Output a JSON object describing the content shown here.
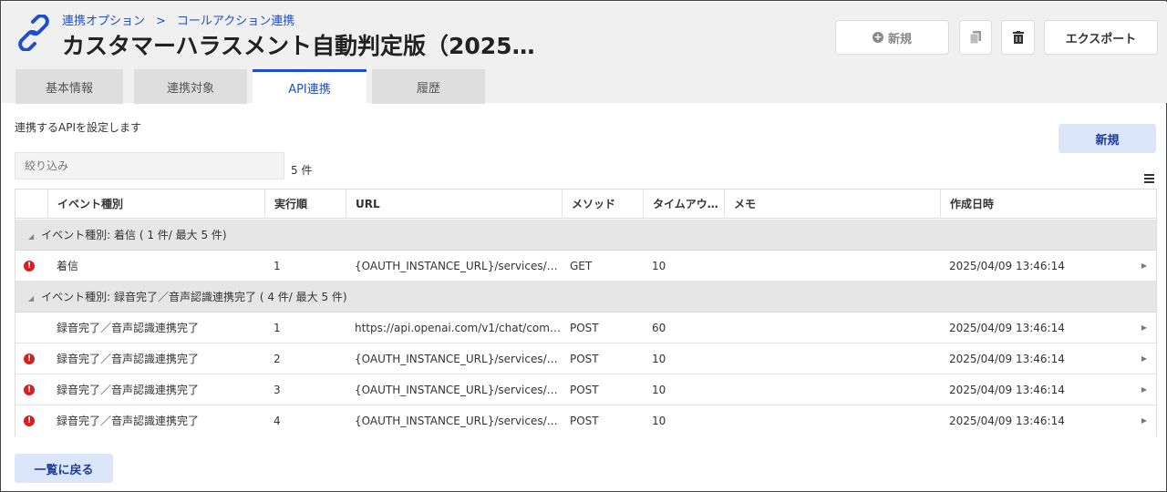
{
  "breadcrumb": [
    "連携オプション",
    ">",
    "コールアクション連携"
  ],
  "title": "カスタマーハラスメント自動判定版（2025…",
  "toolbar": {
    "new_label": "新規",
    "export_label": "エクスポート"
  },
  "tabs": [
    {
      "label": "基本情報",
      "active": false
    },
    {
      "label": "連携対象",
      "active": false
    },
    {
      "label": "API連携",
      "active": true
    },
    {
      "label": "履歴",
      "active": false
    }
  ],
  "description": "連携するAPIを設定します",
  "new_button_label": "新規",
  "filter": {
    "placeholder": "絞り込み"
  },
  "count_label": "5 件",
  "columns": [
    "イベント種別",
    "実行順",
    "URL",
    "メソッド",
    "タイムアウ…",
    "メモ",
    "作成日時"
  ],
  "groups": [
    {
      "label": "イベント種別: 着信 ( 1 件/ 最大 5 件)",
      "rows": [
        {
          "error": true,
          "event": "着信",
          "order": "1",
          "url": "{OAUTH_INSTANCE_URL}/services/…",
          "method": "GET",
          "timeout": "10",
          "memo": "",
          "created": "2025/04/09 13:46:14"
        }
      ]
    },
    {
      "label": "イベント種別: 録音完了／音声認識連携完了 ( 4 件/ 最大 5 件)",
      "rows": [
        {
          "error": false,
          "event": "録音完了／音声認識連携完了",
          "order": "1",
          "url": "https://api.openai.com/v1/chat/com…",
          "method": "POST",
          "timeout": "60",
          "memo": "",
          "created": "2025/04/09 13:46:14"
        },
        {
          "error": true,
          "event": "録音完了／音声認識連携完了",
          "order": "2",
          "url": "{OAUTH_INSTANCE_URL}/services/…",
          "method": "POST",
          "timeout": "10",
          "memo": "",
          "created": "2025/04/09 13:46:14"
        },
        {
          "error": true,
          "event": "録音完了／音声認識連携完了",
          "order": "3",
          "url": "{OAUTH_INSTANCE_URL}/services/…",
          "method": "POST",
          "timeout": "10",
          "memo": "",
          "created": "2025/04/09 13:46:14"
        },
        {
          "error": true,
          "event": "録音完了／音声認識連携完了",
          "order": "4",
          "url": "{OAUTH_INSTANCE_URL}/services/…",
          "method": "POST",
          "timeout": "10",
          "memo": "",
          "created": "2025/04/09 13:46:14"
        }
      ]
    }
  ],
  "back_button_label": "一覧に戻る",
  "colors": {
    "accent": "#1c4fd0",
    "error": "#d62020",
    "button_light": "#dce6fb"
  }
}
